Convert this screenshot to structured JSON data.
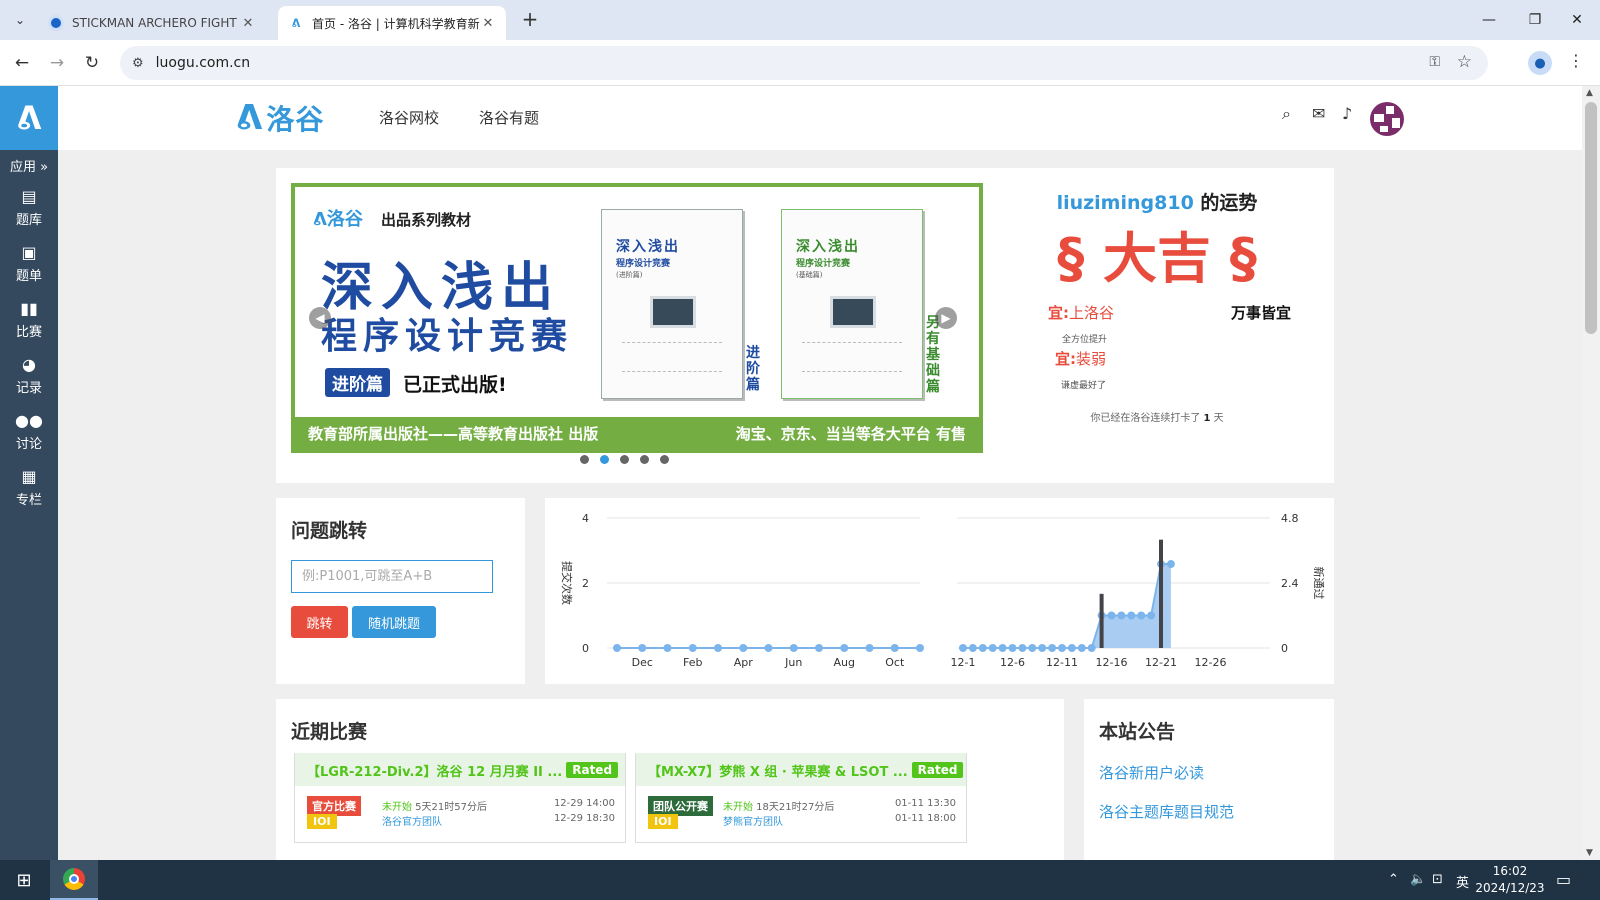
{
  "browser": {
    "tabs": [
      {
        "title": "STICKMAN ARCHERO FIGHT",
        "close": "✕"
      },
      {
        "title": "首页 - 洛谷 | 计算机科学教育新",
        "close": "✕"
      }
    ],
    "new_tab": "+",
    "url": "luogu.com.cn",
    "window_controls": [
      "—",
      "❐",
      "✕"
    ]
  },
  "sidebar": {
    "logo": "ᕕ",
    "apps_label": "应用 »",
    "items": [
      {
        "label": "题库",
        "icon": "book-icon"
      },
      {
        "label": "题单",
        "icon": "clipboard-icon"
      },
      {
        "label": "比赛",
        "icon": "bar-chart-icon"
      },
      {
        "label": "记录",
        "icon": "pie-chart-icon"
      },
      {
        "label": "讨论",
        "icon": "comments-icon"
      },
      {
        "label": "专栏",
        "icon": "newspaper-icon"
      }
    ]
  },
  "header": {
    "brand_mark": "ᕕ",
    "brand_name": "洛谷",
    "nav": [
      "洛谷网校",
      "洛谷有题"
    ]
  },
  "banner": {
    "brand": "ᕕ洛谷",
    "series": "出品系列教材",
    "title_line1": "深入浅出",
    "title_line2": "程序设计竞赛",
    "tag": "进阶篇",
    "published": "已正式出版!",
    "book1_title": "深入浅出",
    "book1_sub": "程序设计竞赛",
    "book1_edition": "(进阶篇)",
    "book1_side": "进阶篇",
    "book2_title": "深入浅出",
    "book2_sub": "程序设计竞赛",
    "book2_edition": "(基础篇)",
    "book2_side": "另有基础篇",
    "footer_left": "教育部所属出版社——高等教育出版社 出版",
    "footer_right": "淘宝、京东、当当等各大平台 有售",
    "slide_count": 5,
    "active_slide": 1
  },
  "fortune": {
    "username": "liuziming810",
    "suffix": " 的运势",
    "result": "§ 大吉 §",
    "good1_label": "宜:",
    "good1_value": "上洛谷",
    "good1_note": "全方位提升",
    "any": "万事皆宜",
    "good2_label": "宜:",
    "good2_value": "装弱",
    "good2_note": "谦虚最好了",
    "streak_prefix": "你已经在洛谷连续打卡了 ",
    "streak_days": "1",
    "streak_suffix": " 天"
  },
  "jump": {
    "title": "问题跳转",
    "placeholder": "例:P1001,可跳至A+B",
    "jump_button": "跳转",
    "random_button": "随机跳题"
  },
  "chart_data": [
    {
      "type": "line",
      "title": "",
      "ylabel": "提交次数",
      "x": [
        "Nov",
        "Dec",
        "Jan",
        "Feb",
        "Mar",
        "Apr",
        "May",
        "Jun",
        "Jul",
        "Aug",
        "Sep",
        "Oct",
        "Nov"
      ],
      "tick_labels": [
        "Dec",
        "Feb",
        "Apr",
        "Jun",
        "Aug",
        "Oct"
      ],
      "values": [
        0,
        0,
        0,
        0,
        0,
        0,
        0,
        0,
        0,
        0,
        0,
        0,
        0
      ],
      "yticks": [
        0,
        2,
        4
      ],
      "ylim": [
        0,
        4
      ],
      "grid": true
    },
    {
      "type": "area",
      "title": "",
      "ylabel": "新通过",
      "x": [
        "12-1",
        "12-2",
        "12-3",
        "12-4",
        "12-5",
        "12-6",
        "12-7",
        "12-8",
        "12-9",
        "12-10",
        "12-11",
        "12-12",
        "12-13",
        "12-14",
        "12-15",
        "12-16",
        "12-17",
        "12-18",
        "12-19",
        "12-20",
        "12-21",
        "12-22"
      ],
      "tick_labels": [
        "12-1",
        "12-6",
        "12-11",
        "12-16",
        "12-21",
        "12-26"
      ],
      "x_end": "12-31",
      "series": [
        {
          "name": "",
          "kind": "area",
          "values": [
            0,
            0,
            0,
            0,
            0,
            0,
            0,
            0,
            0,
            0,
            0,
            0,
            0,
            0,
            1.2,
            1.2,
            1.2,
            1.2,
            1.2,
            1.2,
            3.1,
            3.1
          ]
        },
        {
          "name": "",
          "kind": "bar",
          "values": [
            0,
            0,
            0,
            0,
            0,
            0,
            0,
            0,
            0,
            0,
            0,
            0,
            0,
            0,
            2.0,
            0,
            0,
            0,
            0,
            0,
            4.0,
            0
          ]
        }
      ],
      "yticks": [
        0,
        2.4,
        4.8
      ],
      "ylim": [
        0,
        4.8
      ],
      "grid": true
    }
  ],
  "contests": {
    "title": "近期比赛",
    "items": [
      {
        "title": "【LGR-212-Div.2】洛谷 12 月月赛 II ...",
        "rated": "Rated",
        "type": "官方比赛",
        "type_color": "#e74c3c",
        "format": "IOI",
        "status": "未开始",
        "countdown": " 5天21时57分后",
        "org": "洛谷官方团队",
        "start": "12-29 14:00",
        "end": "12-29 18:30"
      },
      {
        "title": "【MX-X7】梦熊 X 组 · 苹果赛 & LSOT ...",
        "rated": "Rated",
        "type": "团队公开赛",
        "type_color": "#2e6b3b",
        "format": "IOI",
        "status": "未开始",
        "countdown": " 18天21时27分后",
        "org": "梦熊官方团队",
        "start": "01-11 13:30",
        "end": "01-11 18:00"
      }
    ]
  },
  "announcements": {
    "title": "本站公告",
    "items": [
      "洛谷新用户必读",
      "洛谷主题库题目规范"
    ]
  },
  "taskbar": {
    "ime": "英",
    "time": "16:02",
    "date": "2024/12/23",
    "notifications": "1"
  }
}
